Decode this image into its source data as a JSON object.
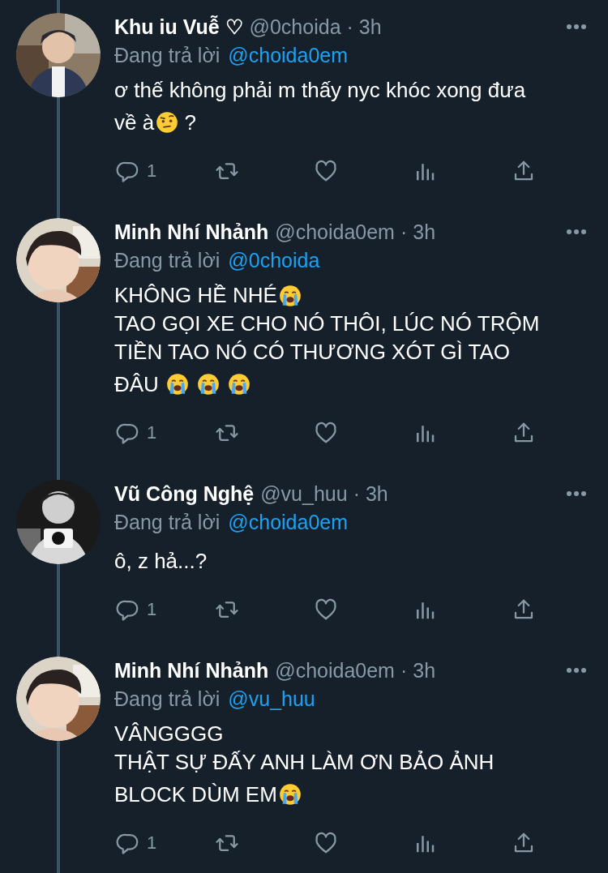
{
  "tweets": [
    {
      "name": "Khu iu Vuễ ♡",
      "handle": "@0choida",
      "separator": "·",
      "time": "3h",
      "reply_prefix": "Đang trả lời",
      "reply_to": "@choida0em",
      "body": [
        [
          {
            "kind": "text",
            "text": "ơ thế không phải m thấy nyc khóc xong đưa"
          }
        ],
        [
          {
            "kind": "text",
            "text": "về à"
          },
          {
            "kind": "squint"
          },
          {
            "kind": "text",
            "text": " ?"
          }
        ]
      ],
      "replies": "1"
    },
    {
      "name": "Minh Nhí Nhảnh",
      "handle": "@choida0em",
      "separator": "·",
      "time": "3h",
      "reply_prefix": "Đang trả lời",
      "reply_to": "@0choida",
      "body": [
        [
          {
            "kind": "text",
            "text": "KHÔNG HỀ NHÉ"
          },
          {
            "kind": "sob"
          }
        ],
        [
          {
            "kind": "text",
            "text": "TAO GỌI XE CHO NÓ THÔI, LÚC NÓ TRỘM"
          }
        ],
        [
          {
            "kind": "text",
            "text": "TIỀN TAO NÓ CÓ THƯƠNG XÓT GÌ TAO"
          }
        ],
        [
          {
            "kind": "text",
            "text": "ĐÂU "
          },
          {
            "kind": "sob"
          },
          {
            "kind": "gap"
          },
          {
            "kind": "sob"
          },
          {
            "kind": "gap"
          },
          {
            "kind": "sob"
          }
        ]
      ],
      "replies": "1"
    },
    {
      "name": "Vũ Công Nghệ",
      "handle": "@vu_huu",
      "separator": "·",
      "time": "3h",
      "reply_prefix": "Đang trả lời",
      "reply_to": "@choida0em",
      "body": [
        [
          {
            "kind": "text",
            "text": "ô, z hả...?"
          }
        ]
      ],
      "replies": "1"
    },
    {
      "name": "Minh Nhí Nhảnh",
      "handle": "@choida0em",
      "separator": "·",
      "time": "3h",
      "reply_prefix": "Đang trả lời",
      "reply_to": "@vu_huu",
      "body": [
        [
          {
            "kind": "text",
            "text": "VÂNGGGG"
          }
        ],
        [
          {
            "kind": "text",
            "text": "THẬT SỰ ĐẤY ANH LÀM ƠN BẢO ẢNH"
          }
        ],
        [
          {
            "kind": "text",
            "text": "BLOCK DÙM EM"
          },
          {
            "kind": "sob"
          }
        ]
      ],
      "replies": "1"
    }
  ]
}
